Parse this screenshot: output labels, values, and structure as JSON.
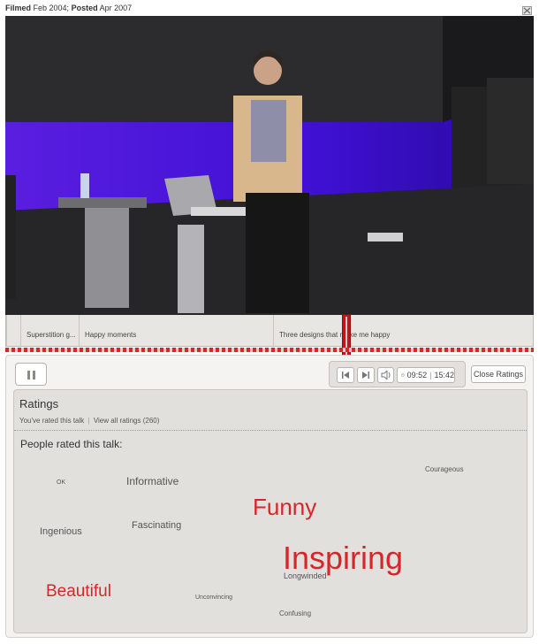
{
  "meta": {
    "filmed_label": "Filmed",
    "filmed_date": "Feb 2004;",
    "posted_label": "Posted",
    "posted_date": "Apr 2007"
  },
  "chapters": [
    {
      "label": ""
    },
    {
      "label": "Superstition g..."
    },
    {
      "label": "Happy moments"
    },
    {
      "label": "Three designs that make me happy"
    }
  ],
  "player": {
    "current_time": "09:52",
    "total_time": "15:42",
    "close_ratings_label": "Close Ratings"
  },
  "ratings": {
    "title": "Ratings",
    "rated_text": "You've rated this talk",
    "separator": "|",
    "view_all": "View all ratings (260)",
    "people_rated": "People rated this talk:",
    "tags": [
      {
        "label": "Courageous",
        "weight": 1
      },
      {
        "label": "OK",
        "weight": 1
      },
      {
        "label": "Informative",
        "weight": 3
      },
      {
        "label": "Funny",
        "weight": 6
      },
      {
        "label": "Fascinating",
        "weight": 2
      },
      {
        "label": "Ingenious",
        "weight": 2
      },
      {
        "label": "Inspiring",
        "weight": 8
      },
      {
        "label": "Longwinded",
        "weight": 1
      },
      {
        "label": "Beautiful",
        "weight": 5
      },
      {
        "label": "Unconvincing",
        "weight": 1
      },
      {
        "label": "Confusing",
        "weight": 1
      }
    ]
  },
  "colors": {
    "accent_red": "#d6262c",
    "stage_purple": "#4a16d8"
  }
}
